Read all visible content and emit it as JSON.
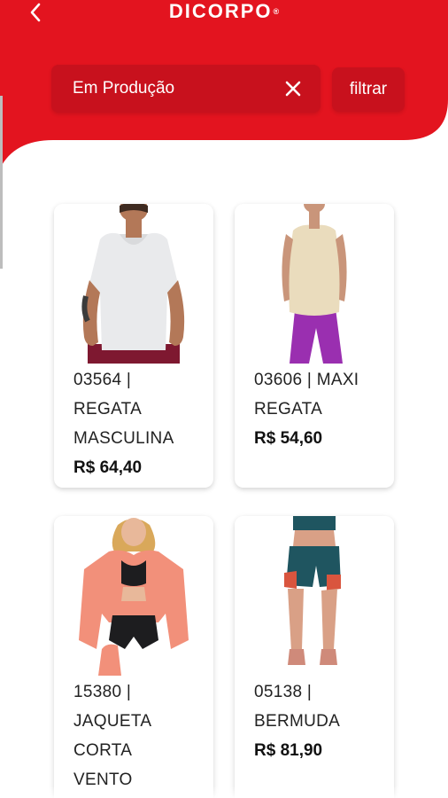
{
  "app": {
    "brand": "DICORPO",
    "brand_mark": "®",
    "colors": {
      "primary": "#e3141f",
      "input_bg": "#c8111d"
    }
  },
  "header": {
    "back_icon": "chevron-left-icon",
    "search": {
      "value": "Em Produção",
      "clear_icon": "close-icon"
    },
    "filter_label": "filtrar"
  },
  "products": [
    {
      "code_line": "03564 |",
      "name_lines": [
        "REGATA",
        "MASCULINA"
      ],
      "price": "R$ 64,40"
    },
    {
      "code_line": "03606 | MAXI",
      "name_lines": [
        "REGATA"
      ],
      "price": "R$ 54,60"
    },
    {
      "code_line": "15380 |",
      "name_lines": [
        "JAQUETA",
        "CORTA",
        "VENTO"
      ],
      "price": ""
    },
    {
      "code_line": "05138 |",
      "name_lines": [
        "BERMUDA"
      ],
      "price": "R$ 81,90"
    }
  ]
}
